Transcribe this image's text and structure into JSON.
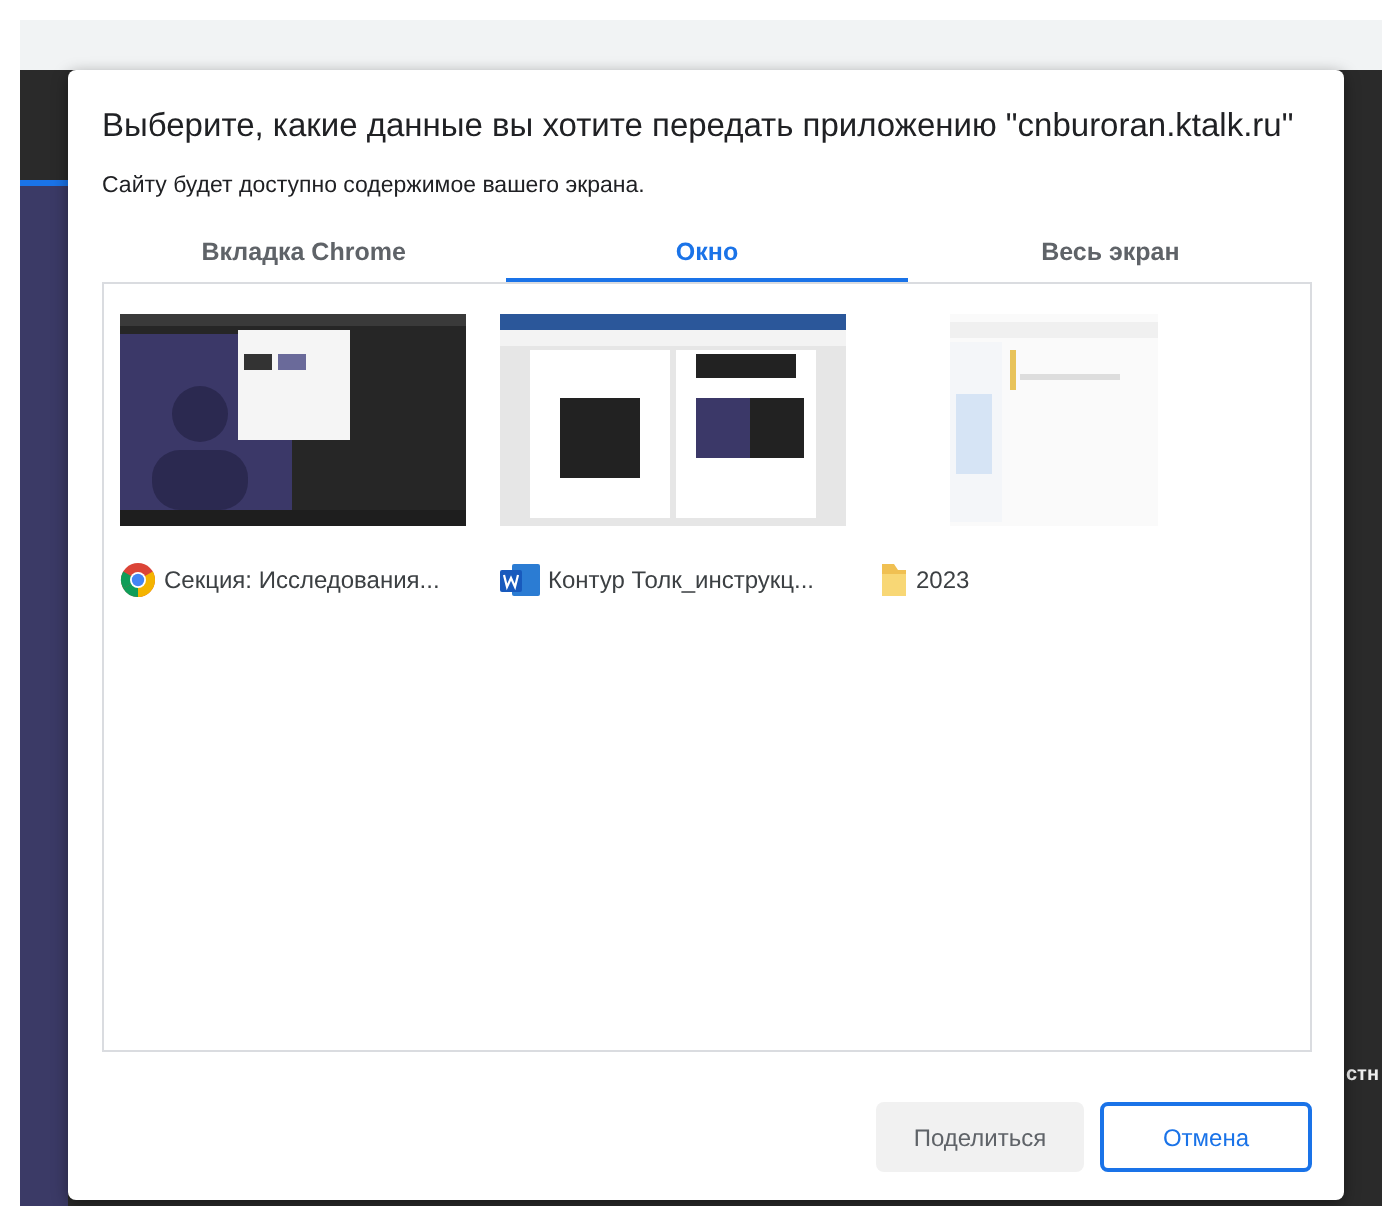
{
  "background": {
    "partial_text": "стн"
  },
  "dialog": {
    "title": "Выберите, какие данные вы хотите передать приложению \"cnburoran.ktalk.ru\"",
    "subtitle": "Сайту будет доступно содержимое вашего экрана.",
    "tabs": [
      {
        "label": "Вкладка Chrome",
        "selected": false
      },
      {
        "label": "Окно",
        "selected": true
      },
      {
        "label": "Весь экран",
        "selected": false
      }
    ],
    "windows": [
      {
        "kind": "browser",
        "title": "Секция: Исследования..."
      },
      {
        "kind": "document",
        "title": "Контур Толк_инструкц..."
      },
      {
        "kind": "folder",
        "title": "2023"
      }
    ],
    "buttons": [
      {
        "label": "Поделиться",
        "kind": "share",
        "disabled": true
      },
      {
        "label": "Отмена",
        "kind": "cancel",
        "disabled": false
      }
    ]
  }
}
